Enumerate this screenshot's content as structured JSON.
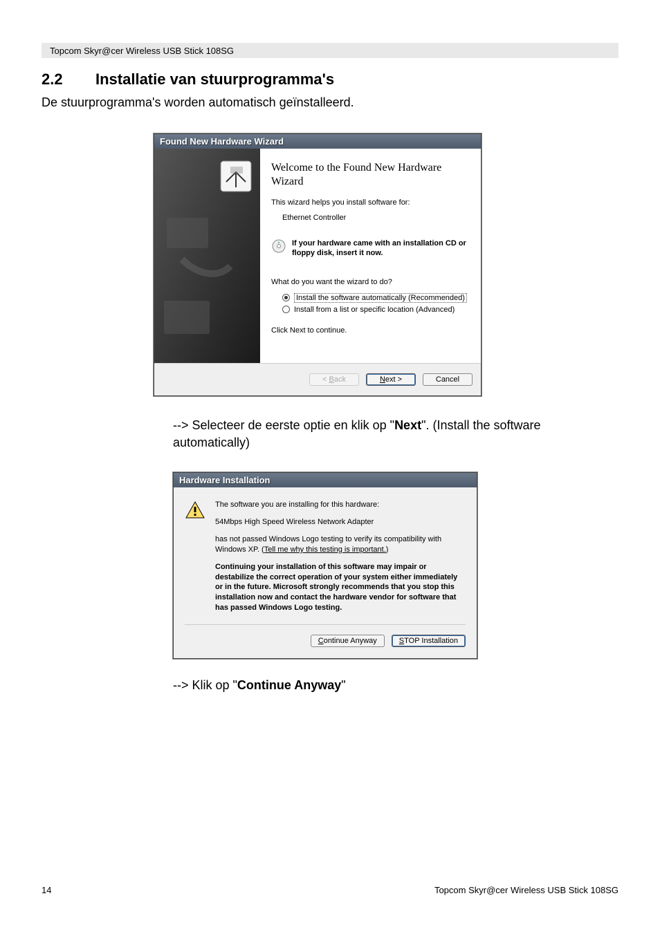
{
  "header": {
    "product": "Topcom Skyr@cer Wireless USB Stick 108SG"
  },
  "section": {
    "number": "2.2",
    "title": "Installatie van stuurprogramma's"
  },
  "intro": "De stuurprogramma's worden automatisch geïnstalleerd.",
  "wizard": {
    "title": "Found New Hardware Wizard",
    "heading": "Welcome to the Found New Hardware Wizard",
    "helps": "This wizard helps you install software for:",
    "device": "Ethernet Controller",
    "cd_notice": "If your hardware came with an installation CD or floppy disk, insert it now.",
    "question": "What do you want the wizard to do?",
    "opt1": "Install the software automatically (Recommended)",
    "opt2": "Install from a list or specific location (Advanced)",
    "click_next": "Click Next to continue.",
    "btn_back": "< Back",
    "btn_next": "Next >",
    "btn_cancel": "Cancel"
  },
  "instruction1_prefix": "-->  Selecteer de eerste optie en klik op \"",
  "instruction1_bold": "Next",
  "instruction1_suffix": "\". (Install the software automatically)",
  "hw": {
    "title": "Hardware Installation",
    "line1": "The software you are installing for this hardware:",
    "line2": "54Mbps High Speed Wireless Network Adapter",
    "line3a": "has not passed Windows Logo testing to verify its compatibility with Windows XP. (",
    "line3link": "Tell me why this testing is important.",
    "line3b": ")",
    "warn": "Continuing your installation of this software may impair or destabilize the correct operation of your system either immediately or in the future. Microsoft strongly recommends that you stop this installation now and contact the hardware vendor for software that has passed Windows Logo testing.",
    "btn_continue": "Continue Anyway",
    "btn_stop": "STOP Installation"
  },
  "instruction2_prefix": "--> Klik op \"",
  "instruction2_bold": "Continue Anyway",
  "instruction2_suffix": "\"",
  "footer": {
    "page": "14",
    "product": "Topcom Skyr@cer Wireless USB Stick 108SG"
  }
}
